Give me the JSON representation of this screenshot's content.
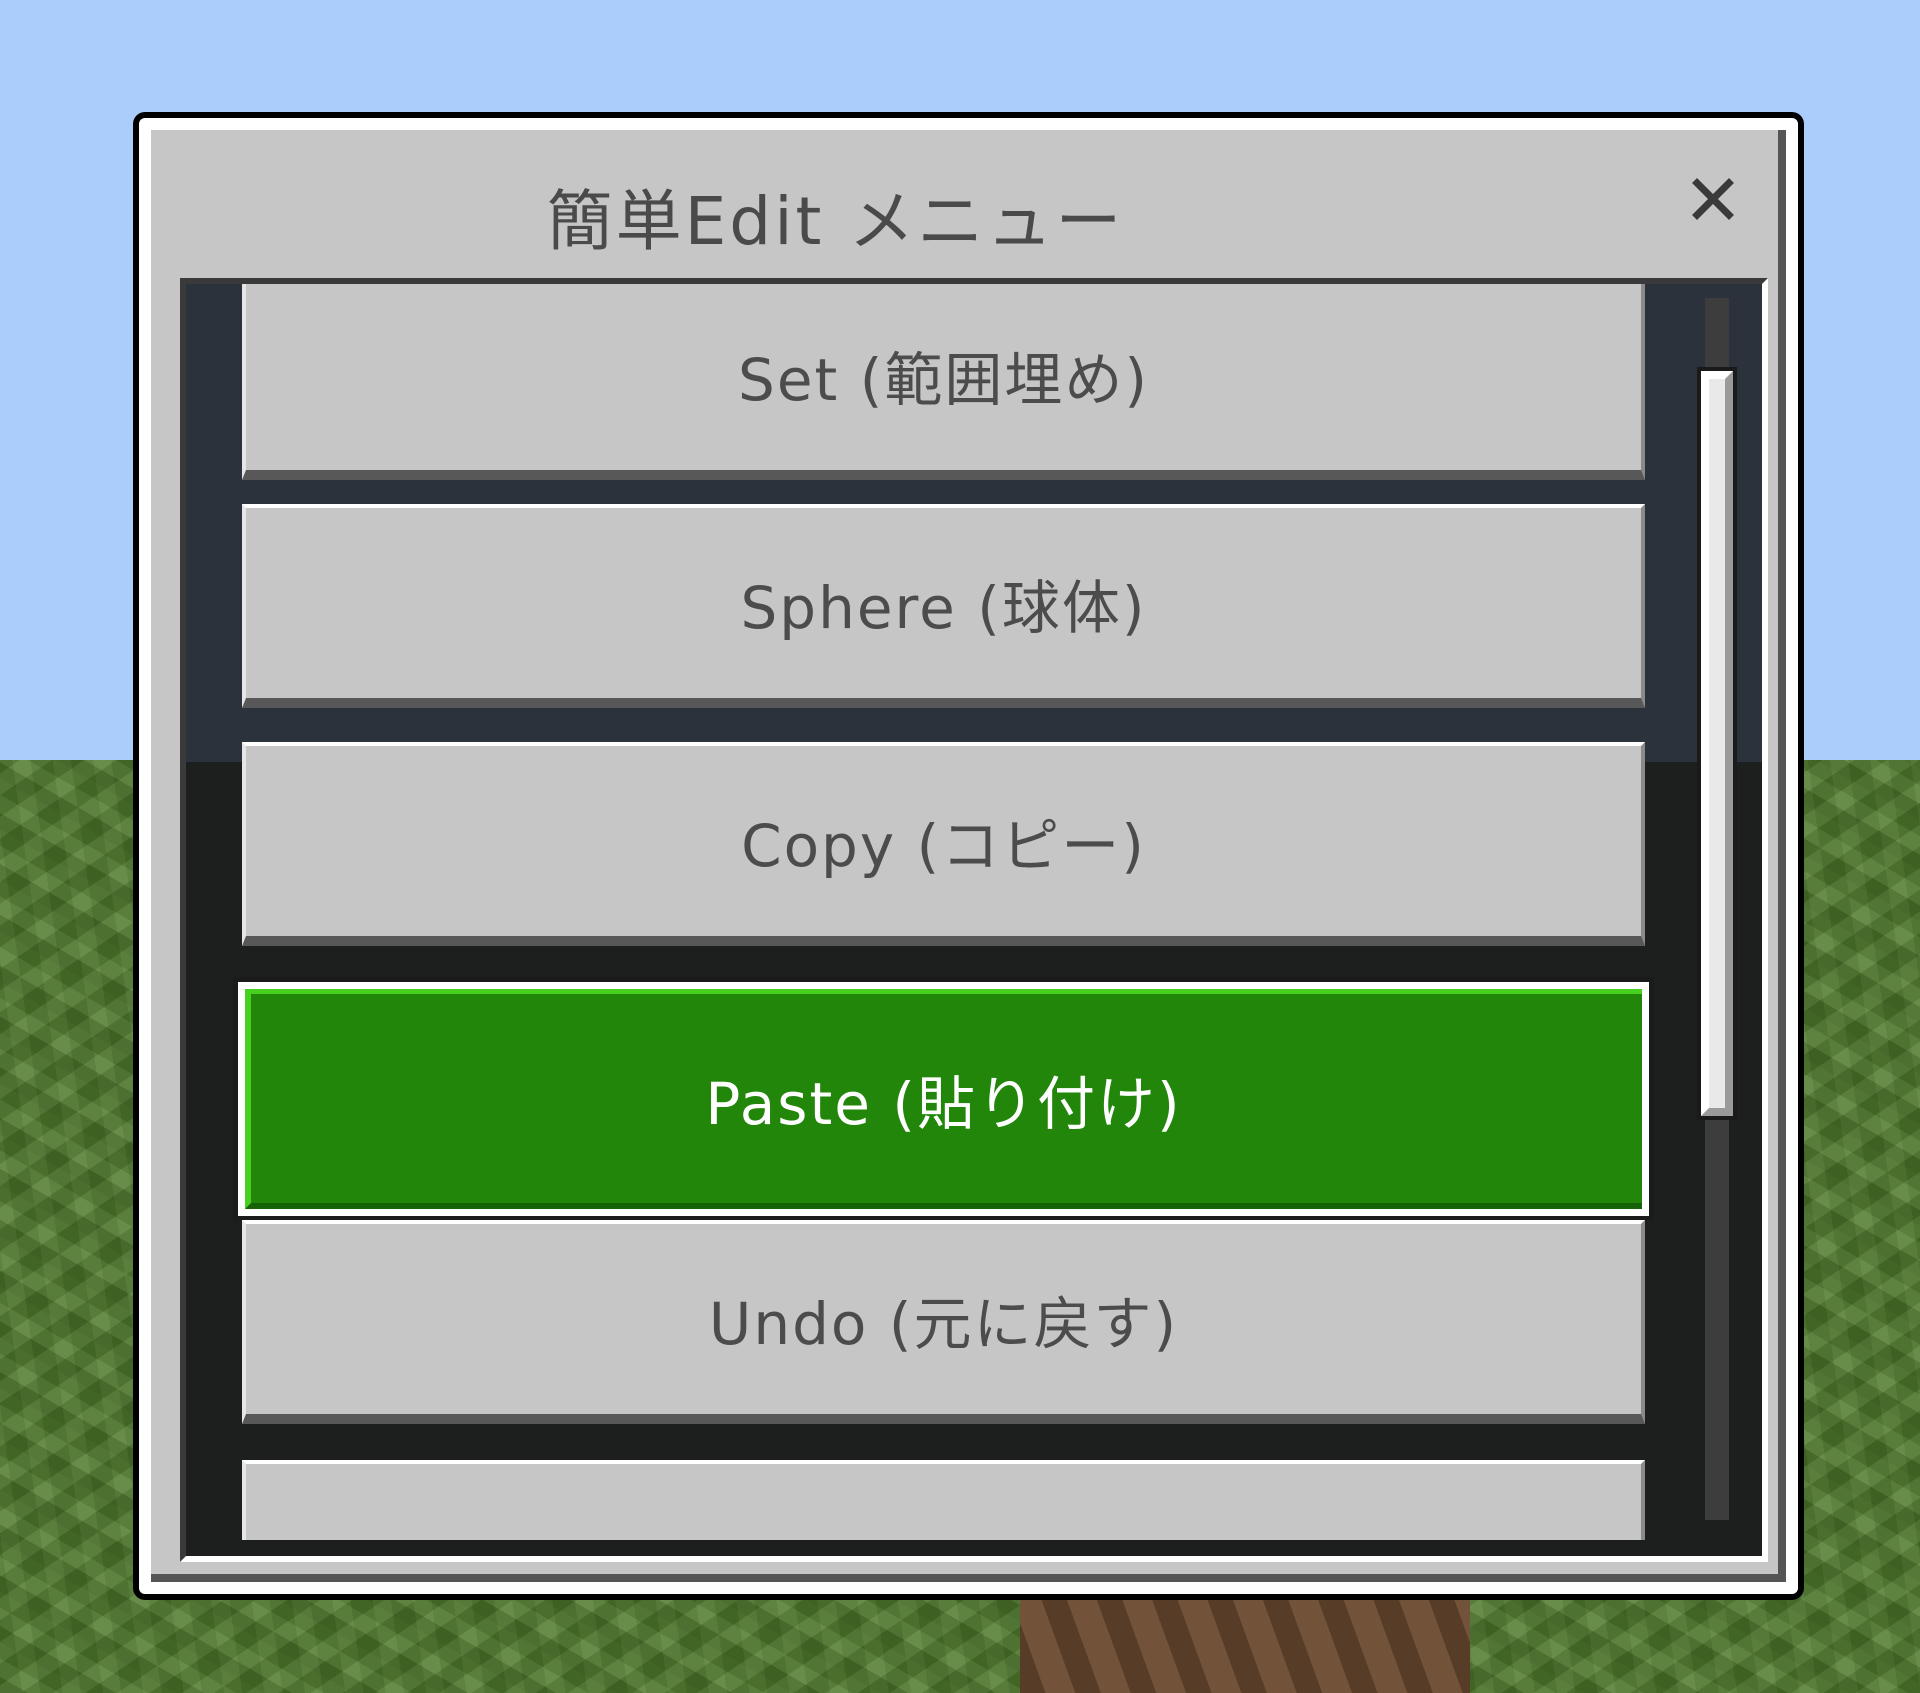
{
  "dialog": {
    "title": "簡単Edit メニュー",
    "close_icon": "close-icon"
  },
  "menu": {
    "items": [
      {
        "label": "Set (範囲埋め)",
        "selected": false
      },
      {
        "label": "Sphere (球体)",
        "selected": false
      },
      {
        "label": "Copy (コピー)",
        "selected": false
      },
      {
        "label": "Paste (貼り付け)",
        "selected": true
      },
      {
        "label": "Undo (元に戻す)",
        "selected": false
      },
      {
        "label": "",
        "selected": false
      }
    ],
    "scroll_fraction_visible": 0.61,
    "scroll_fraction_offset": 0.06
  },
  "colors": {
    "selected_button": "#21860a",
    "button": "#c6c6c6",
    "sky": "#aacdfb",
    "grass": "#4f7a2c"
  }
}
